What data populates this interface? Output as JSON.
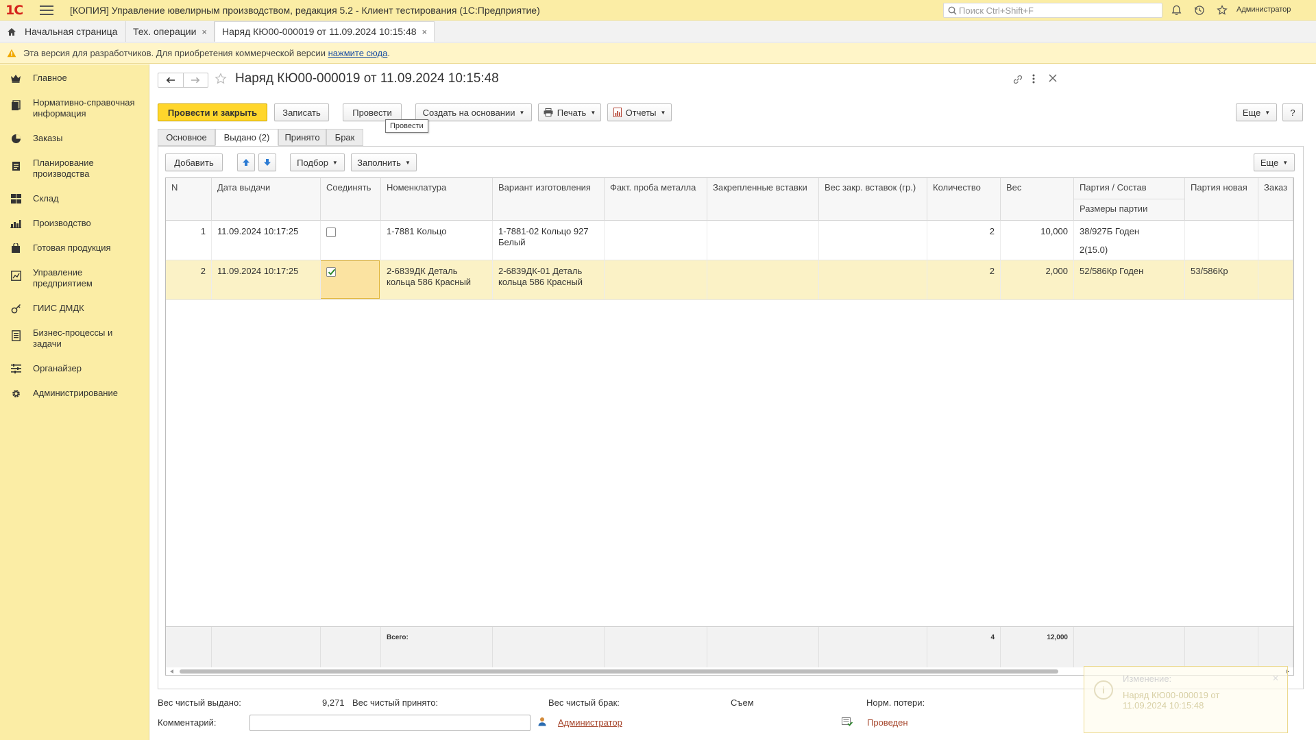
{
  "app": {
    "logo": "1С",
    "title": "[КОПИЯ] Управление ювелирным производством, редакция 5.2  - Клиент тестирования (1С:Предприятие)",
    "search_placeholder": "Поиск Ctrl+Shift+F",
    "user": "Администратор"
  },
  "tabs": [
    {
      "label": "Начальная страница"
    },
    {
      "label": "Тех. операции",
      "close": "×"
    },
    {
      "label": "Наряд КЮ00-000019 от 11.09.2024 10:15:48",
      "close": "×"
    }
  ],
  "banner": {
    "text": "Эта версия для разработчиков. Для приобретения коммерческой версии ",
    "link": "нажмите сюда",
    "suffix": "."
  },
  "sidebar": {
    "items": [
      {
        "label": "Главное",
        "icon": "crown-icon"
      },
      {
        "label": "Нормативно-справочная информация",
        "icon": "reference-book-icon"
      },
      {
        "label": "Заказы",
        "icon": "orders-pie-icon"
      },
      {
        "label": "Планирование производства",
        "icon": "planning-icon"
      },
      {
        "label": "Склад",
        "icon": "warehouse-grid-icon"
      },
      {
        "label": "Производство",
        "icon": "production-chart-icon"
      },
      {
        "label": "Готовая продукция",
        "icon": "bag-icon"
      },
      {
        "label": "Управление предприятием",
        "icon": "enterprise-icon"
      },
      {
        "label": "ГИИС ДМДК",
        "icon": "giis-icon"
      },
      {
        "label": "Бизнес-процессы и задачи",
        "icon": "processes-icon"
      },
      {
        "label": "Органайзер",
        "icon": "organizer-icon"
      },
      {
        "label": "Администрирование",
        "icon": "gear-icon"
      }
    ]
  },
  "form": {
    "title": "Наряд КЮ00-000019 от 11.09.2024 10:15:48",
    "buttons": {
      "post_close": "Провести и закрыть",
      "save": "Записать",
      "post": "Провести",
      "create_based": "Создать на основании",
      "print": "Печать",
      "reports": "Отчеты",
      "more": "Еще",
      "help": "?"
    },
    "tooltip": "Провести",
    "tabs": [
      "Основное",
      "Выдано (2)",
      "Принято",
      "Брак"
    ],
    "active_tab": "Выдано (2)",
    "grid_toolbar": {
      "add": "Добавить",
      "pick": "Подбор",
      "fill": "Заполнить",
      "more": "Еще"
    },
    "table": {
      "columns": [
        "N",
        "Дата выдачи",
        "Соединять",
        "Номенклатура",
        "Вариант изготовления",
        "Факт. проба металла",
        "Закрепленные вставки",
        "Вес закр. вставок (гр.)",
        "Количество",
        "Вес",
        "Партия / Состав",
        "Партия новая",
        "Заказ"
      ],
      "subcolumn": "Размеры партии",
      "rows": [
        {
          "n": "1",
          "date": "11.09.2024 10:17:25",
          "join": false,
          "nomenclature": "1-7881 Кольцо",
          "variant": "1-7881-02 Кольцо 927 Белый",
          "assay": "",
          "inserts": "",
          "inserts_weight": "",
          "qty": "2",
          "weight": "10,000",
          "batch": "38/927Б Годен",
          "batch_sizes": "2(15.0)",
          "batch_new": "",
          "order": ""
        },
        {
          "n": "2",
          "date": "11.09.2024 10:17:25",
          "join": true,
          "nomenclature": "2-6839ДК Деталь кольца 586 Красный",
          "variant": "2-6839ДК-01 Деталь кольца 586 Красный",
          "assay": "",
          "inserts": "",
          "inserts_weight": "",
          "qty": "2",
          "weight": "2,000",
          "batch": "52/586Кр Годен",
          "batch_sizes": "",
          "batch_new": "53/586Кр",
          "order": ""
        }
      ],
      "footer": {
        "label": "Всего:",
        "qty": "4",
        "weight": "12,000"
      }
    },
    "bottom": {
      "net_issued_label": "Вес чистый выдано:",
      "net_issued_value": "9,271",
      "net_received_label": "Вес чистый принято:",
      "net_defect_label": "Вес чистый брак:",
      "removal_label": "Съем",
      "norm_loss_label": "Норм. потери:",
      "comment_label": "Комментарий:",
      "comment_value": "",
      "author": "Администратор",
      "status": "Проведен"
    }
  },
  "notification": {
    "title": "Изменение:",
    "body": "Наряд КЮ00-000019 от 11.09.2024 10:15:48",
    "icon": "info-icon"
  },
  "colors": {
    "accent_yellow": "#fbeda5",
    "primary_button": "#ffd62c",
    "selected_row": "#fbf2c6",
    "link": "#1a4ea3",
    "status_link": "#a5442a"
  }
}
